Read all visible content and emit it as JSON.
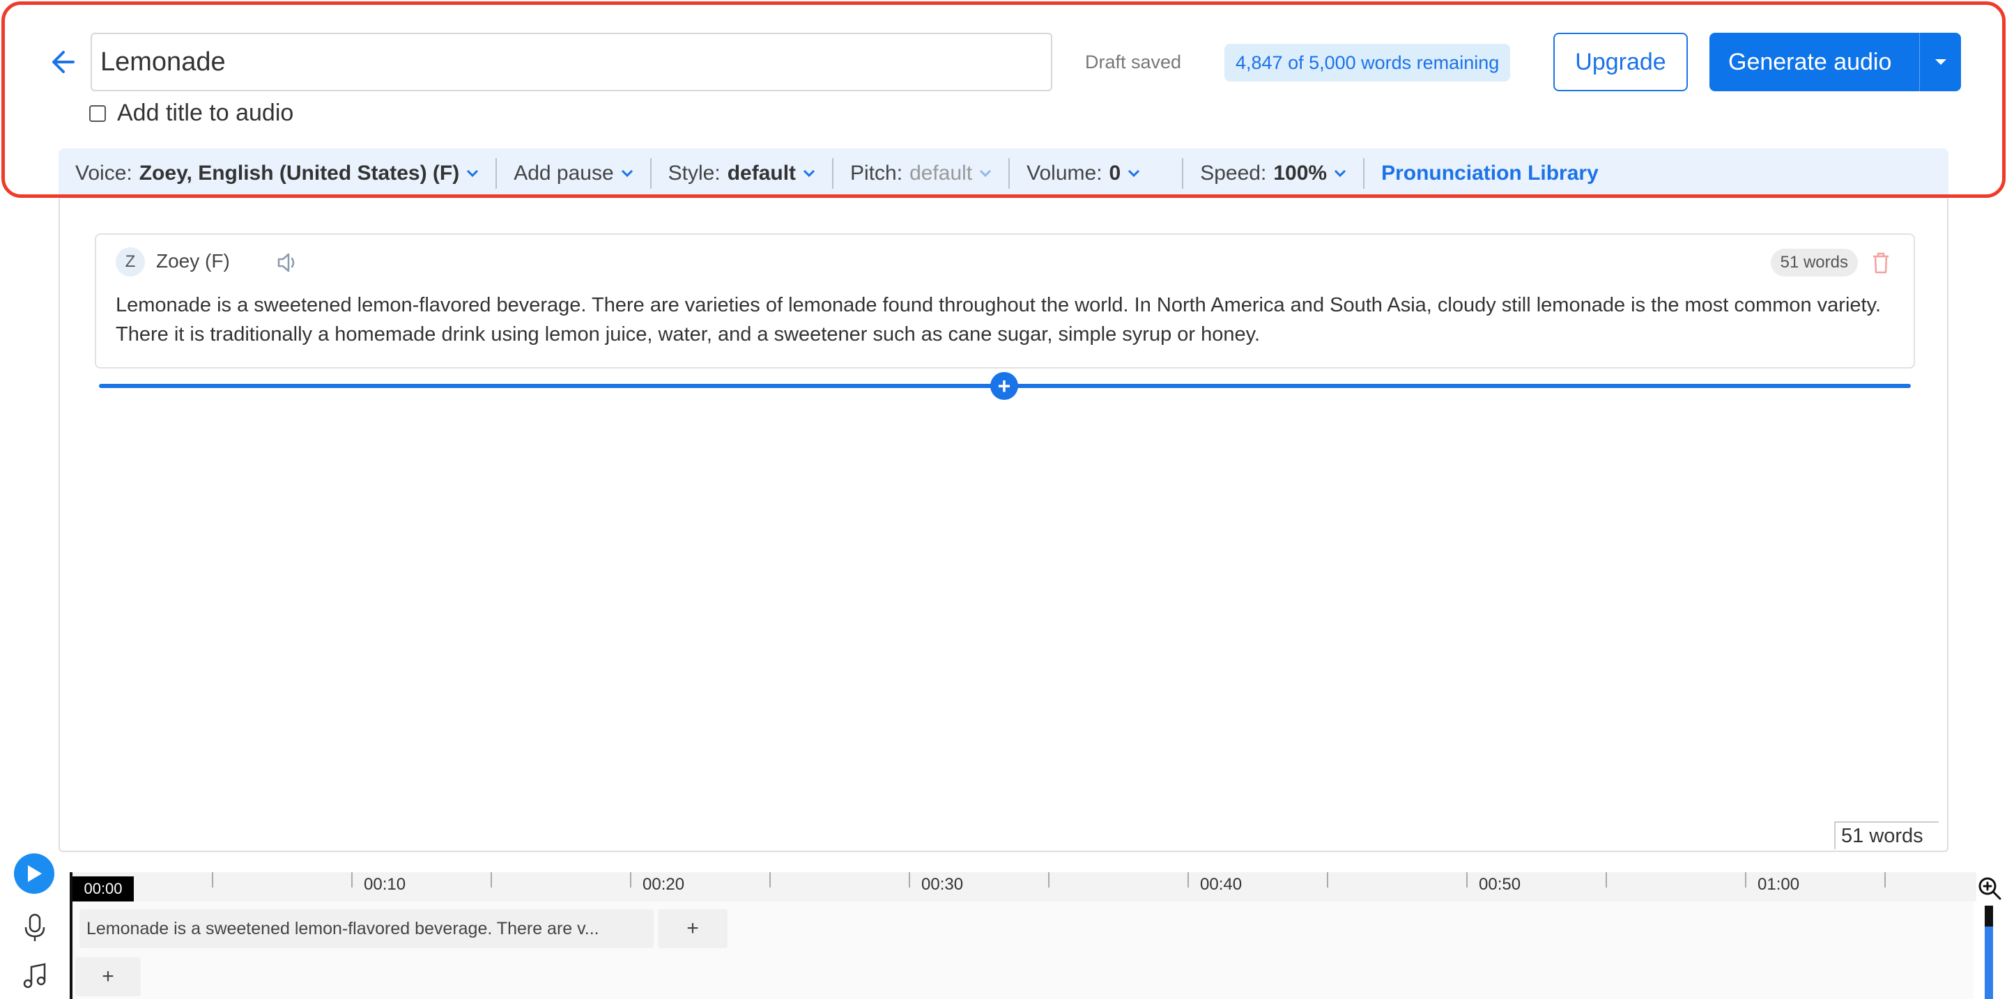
{
  "header": {
    "title_value": "Lemonade",
    "add_title_label": "Add title to audio",
    "draft_status": "Draft saved",
    "words_remaining": "4,847 of 5,000 words remaining",
    "upgrade_label": "Upgrade",
    "generate_label": "Generate audio"
  },
  "toolbar": {
    "voice_label": "Voice:",
    "voice_value": "Zoey, English (United States) (F)",
    "pause_label": "Add pause",
    "style_label": "Style:",
    "style_value": "default",
    "pitch_label": "Pitch:",
    "pitch_value": "default",
    "volume_label": "Volume:",
    "volume_value": "0",
    "speed_label": "Speed:",
    "speed_value": "100%",
    "pronunciation_label": "Pronunciation Library"
  },
  "editor": {
    "block": {
      "avatar_letter": "Z",
      "voice_name": "Zoey (F)",
      "word_count": "51 words",
      "text": "Lemonade is a sweetened lemon-flavored beverage. There are varieties of lemonade found throughout the world. In North America and South Asia, cloudy still lemonade is the most common variety. There it is traditionally a homemade drink using lemon juice, water, and a sweetener such as cane sugar, simple syrup or honey."
    },
    "insert_symbol": "+",
    "total_words": "51 words"
  },
  "timeline": {
    "current_time": "00:00",
    "labels": [
      "00:10",
      "00:20",
      "00:30",
      "00:40",
      "00:50",
      "01:00"
    ],
    "clip_text": "Lemonade is a sweetened lemon-flavored beverage. There are v...",
    "clip_add": "+",
    "track_add": "+"
  },
  "colors": {
    "accent": "#1b73e8",
    "highlight": "#ef3b2a",
    "toolbar_bg": "#e9f2fd"
  },
  "icons": [
    "back-arrow-icon",
    "chevron-down-icon",
    "speaker-icon",
    "trash-icon",
    "plus-icon",
    "play-icon",
    "microphone-icon",
    "music-note-icon",
    "zoom-in-icon"
  ]
}
